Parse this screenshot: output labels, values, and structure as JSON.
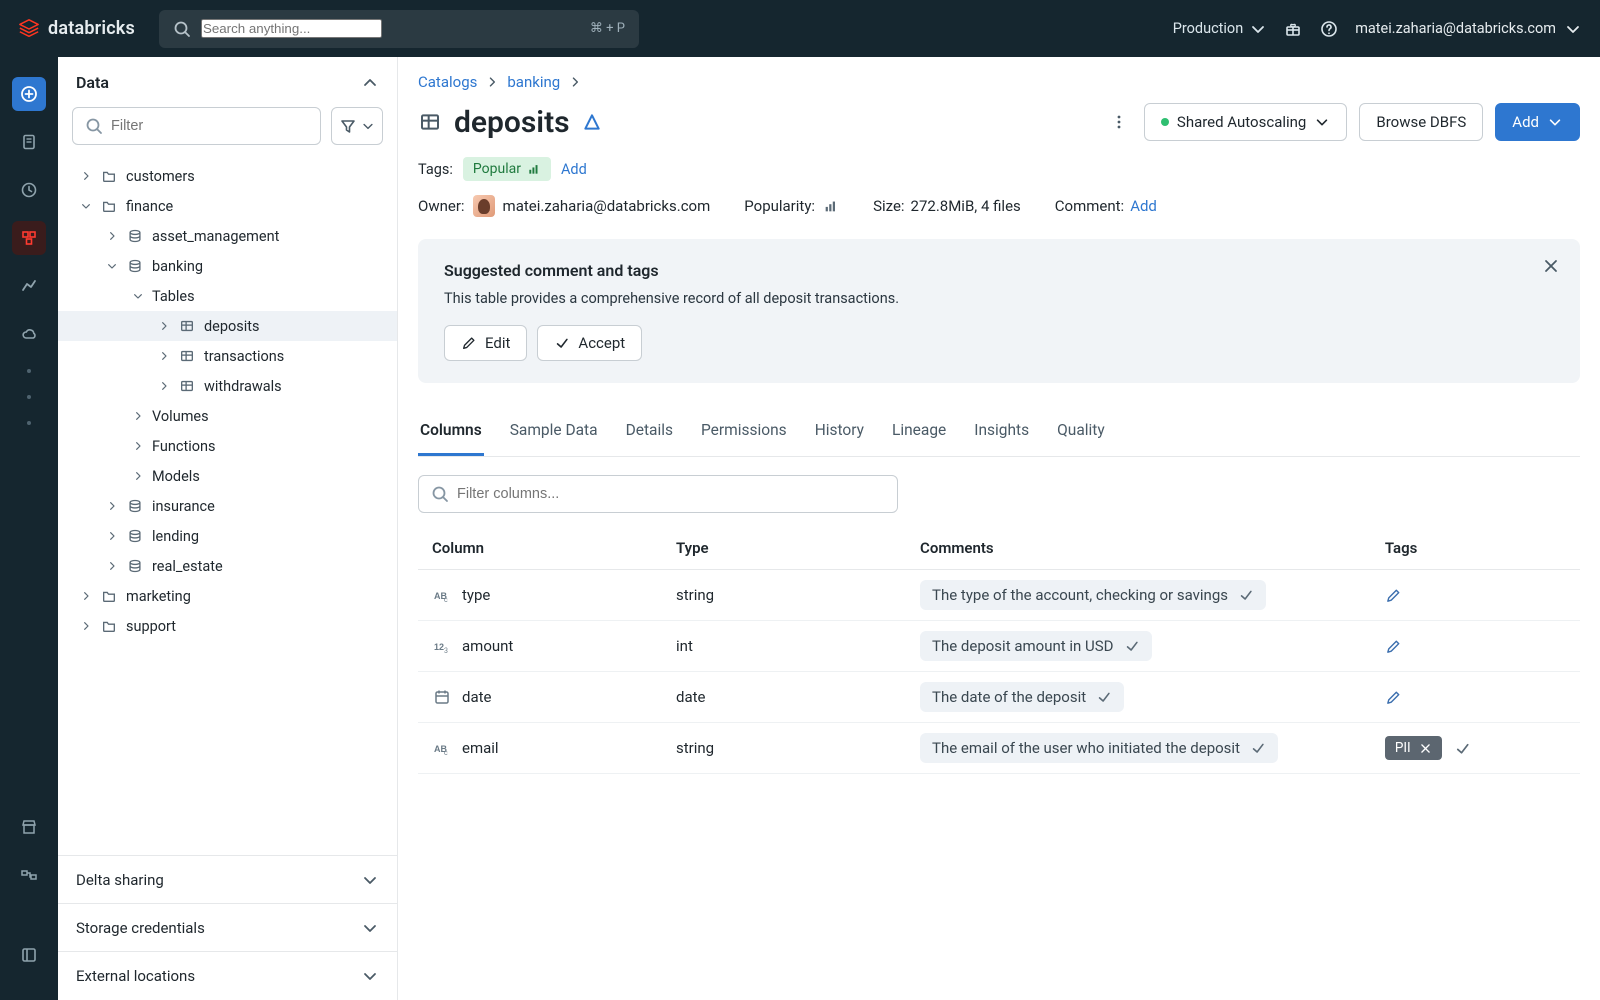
{
  "topbar": {
    "brand": "databricks",
    "search_placeholder": "Search anything...",
    "search_shortcut": "⌘ + P",
    "environment": "Production",
    "user_email": "matei.zaharia@databricks.com"
  },
  "sidepanel": {
    "header": "Data",
    "filter_placeholder": "Filter",
    "bottom_sections": [
      "Delta sharing",
      "Storage credentials",
      "External locations"
    ]
  },
  "tree": {
    "customers": "customers",
    "finance": "finance",
    "asset_management": "asset_management",
    "banking": "banking",
    "tables": "Tables",
    "deposits": "deposits",
    "transactions": "transactions",
    "withdrawals": "withdrawals",
    "volumes": "Volumes",
    "functions": "Functions",
    "models": "Models",
    "insurance": "insurance",
    "lending": "lending",
    "real_estate": "real_estate",
    "marketing": "marketing",
    "support": "support"
  },
  "breadcrumb": {
    "catalogs": "Catalogs",
    "banking": "banking"
  },
  "page": {
    "title": "deposits",
    "tags_label": "Tags:",
    "popular_tag": "Popular",
    "add_link": "Add",
    "owner_label": "Owner:",
    "owner_value": "matei.zaharia@databricks.com",
    "popularity_label": "Popularity:",
    "size_label": "Size:",
    "size_value": "272.8MiB, 4 files",
    "comment_label": "Comment:",
    "comment_add": "Add"
  },
  "actions": {
    "cluster": "Shared Autoscaling",
    "browse": "Browse DBFS",
    "add": "Add"
  },
  "suggest": {
    "title": "Suggested comment and tags",
    "body": "This table provides a comprehensive record of all deposit transactions.",
    "edit": "Edit",
    "accept": "Accept"
  },
  "tabs": [
    "Columns",
    "Sample Data",
    "Details",
    "Permissions",
    "History",
    "Lineage",
    "Insights",
    "Quality"
  ],
  "columns": {
    "filter_placeholder": "Filter columns...",
    "headers": {
      "column": "Column",
      "type": "Type",
      "comments": "Comments",
      "tags": "Tags"
    },
    "rows": [
      {
        "name": "type",
        "dtype": "string",
        "type_icon": "abc",
        "comment": "The type of the account, checking or savings",
        "tag": null
      },
      {
        "name": "amount",
        "dtype": "int",
        "type_icon": "123",
        "comment": "The deposit amount in USD",
        "tag": null
      },
      {
        "name": "date",
        "dtype": "date",
        "type_icon": "date",
        "comment": "The date of the deposit",
        "tag": null
      },
      {
        "name": "email",
        "dtype": "string",
        "type_icon": "abc",
        "comment": "The email of the user who initiated the deposit",
        "tag": "PII"
      }
    ]
  }
}
